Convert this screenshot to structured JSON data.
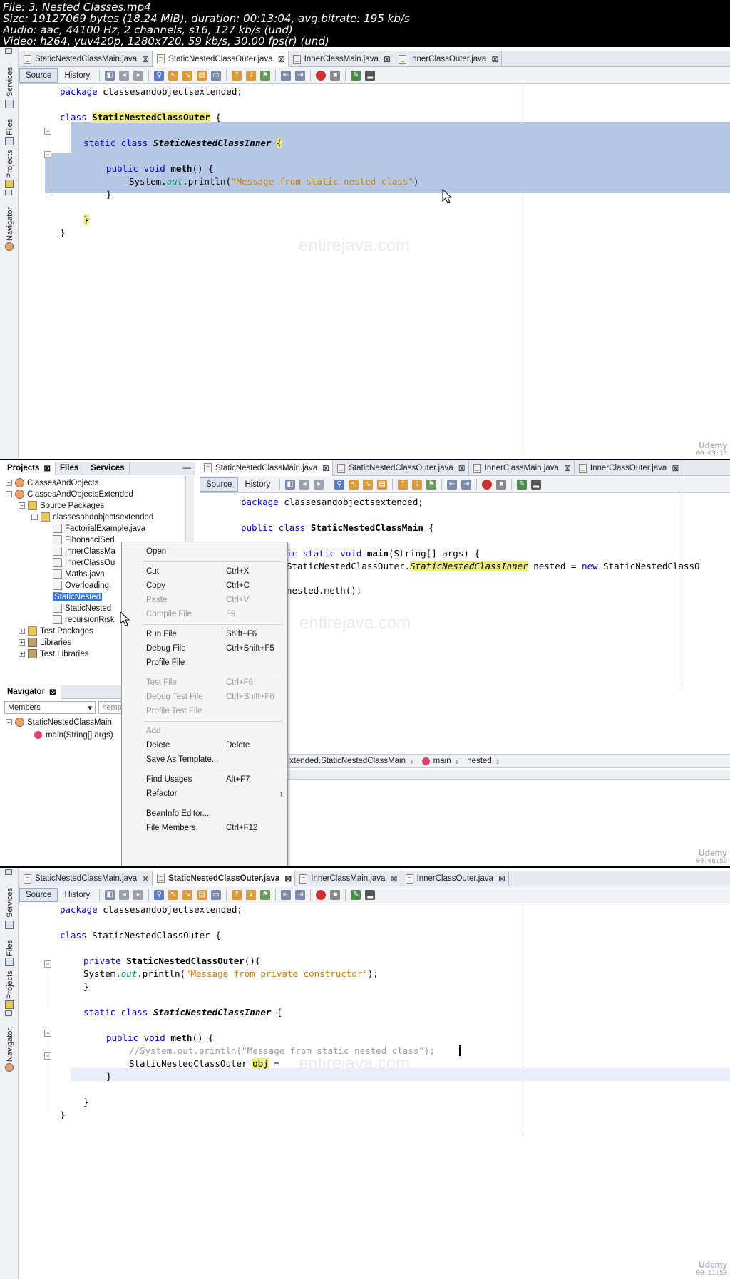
{
  "header": {
    "line1": "File: 3. Nested Classes.mp4",
    "line2": "Size: 19127069 bytes (18.24 MiB), duration: 00:13:04, avg.bitrate: 195 kb/s",
    "line3": "Audio: aac, 44100 Hz, 2 channels, s16, 127 kb/s (und)",
    "line4": "Video: h264, yuv420p, 1280x720, 59 kb/s, 30.00 fps(r) (und)"
  },
  "side_tabs": {
    "services": "Services",
    "files": "Files",
    "projects": "Projects",
    "navigator": "Navigator"
  },
  "toolbar": {
    "source": "Source",
    "history": "History"
  },
  "watermark": "entirejava.com",
  "udemy": {
    "brand": "Udemy",
    "t1": "00:03:13",
    "t2": "00:06:59",
    "t3": "00:11:53"
  },
  "frame1": {
    "tabs": [
      "StaticNestedClassMain.java",
      "StaticNestedClassOuter.java",
      "InnerClassMain.java",
      "InnerClassOuter.java"
    ],
    "code": {
      "l1_kw": "package",
      "l1_rest": " classesandobjectsextended;",
      "l2_kw": "class",
      "l2_name": "StaticNestedClassOuter",
      "l2_rest": " {",
      "l3_kw": "static class",
      "l3_name": "StaticNestedClassInner",
      "l3_brace": "{",
      "l4_kw": "public void",
      "l4_name": "meth",
      "l4_rest": "() {",
      "l5_a": "System.",
      "l5_fld": "out",
      "l5_b": ".println(",
      "l5_str": "\"Message from static nested class\"",
      "l5_c": ")",
      "l6": "}",
      "l7": "}",
      "l8": "}"
    }
  },
  "frame2": {
    "projects_tabs": [
      "Projects",
      "Files",
      "Services"
    ],
    "tree": [
      "ClassesAndObjects",
      "ClassesAndObjectsExtended",
      "Source Packages",
      "classesandobjectsextended",
      "FactorialExample.java",
      "FibonacciSeri",
      "InnerClassMa",
      "InnerClassOu",
      "Maths.java",
      "Overloading.",
      "StaticNested",
      "StaticNested",
      "recursionRisk",
      "Test Packages",
      "Libraries",
      "Test Libraries"
    ],
    "navigator_title": "Navigator",
    "members_combo": "Members",
    "empty_combo": "<emp",
    "nav_tree": [
      "StaticNestedClassMain",
      "main(String[] args)"
    ],
    "tabs": [
      "StaticNestedClassMain.java",
      "StaticNestedClassOuter.java",
      "InnerClassMain.java",
      "InnerClassOuter.java"
    ],
    "code": {
      "l1_kw": "package",
      "l1_rest": " classesandobjectsextended;",
      "l2_kw": "public class",
      "l2_name": "StaticNestedClassMain",
      "l2_rest": " {",
      "l3_kw1": "ic static void",
      "l3_name": "main",
      "l3_rest": "(String[] args) {",
      "l4_a": "StaticNestedClassOuter.",
      "l4_name": "StaticNestedClassInner",
      "l4_b": " nested = ",
      "l4_kw": "new",
      "l4_c": " StaticNestedClassO",
      "l5": "nested.meth();"
    },
    "breadcrumb": [
      "xtended.StaticNestedClassMain",
      "main",
      "nested"
    ],
    "menu": [
      {
        "label": "Open",
        "shortcut": "",
        "disabled": false
      },
      {
        "label": "Cut",
        "shortcut": "Ctrl+X",
        "disabled": false
      },
      {
        "label": "Copy",
        "shortcut": "Ctrl+C",
        "disabled": false
      },
      {
        "label": "Paste",
        "shortcut": "Ctrl+V",
        "disabled": true
      },
      {
        "label": "Compile File",
        "shortcut": "F9",
        "disabled": true
      },
      {
        "label": "Run File",
        "shortcut": "Shift+F6",
        "disabled": false
      },
      {
        "label": "Debug File",
        "shortcut": "Ctrl+Shift+F5",
        "disabled": false
      },
      {
        "label": "Profile File",
        "shortcut": "",
        "disabled": false
      },
      {
        "label": "Test File",
        "shortcut": "Ctrl+F6",
        "disabled": true
      },
      {
        "label": "Debug Test File",
        "shortcut": "Ctrl+Shift+F6",
        "disabled": true
      },
      {
        "label": "Profile Test File",
        "shortcut": "",
        "disabled": true
      },
      {
        "label": "Add",
        "shortcut": "",
        "disabled": true
      },
      {
        "label": "Delete",
        "shortcut": "Delete",
        "disabled": false
      },
      {
        "label": "Save As Template...",
        "shortcut": "",
        "disabled": false
      },
      {
        "label": "Find Usages",
        "shortcut": "Alt+F7",
        "disabled": false
      },
      {
        "label": "Refactor",
        "shortcut": "",
        "disabled": false
      },
      {
        "label": "BeanInfo Editor...",
        "shortcut": "",
        "disabled": false
      },
      {
        "label": "File Members",
        "shortcut": "Ctrl+F12",
        "disabled": false
      }
    ]
  },
  "frame3": {
    "tabs": [
      "StaticNestedClassMain.java",
      "StaticNestedClassOuter.java",
      "InnerClassMain.java",
      "InnerClassOuter.java"
    ],
    "code": {
      "l1_kw": "package",
      "l1_rest": " classesandobjectsextended;",
      "l2_kw": "class",
      "l2_rest": " StaticNestedClassOuter {",
      "l3_kw": "private",
      "l3_name": "StaticNestedClassOuter",
      "l3_rest": "(){",
      "l4_a": "System.",
      "l4_fld": "out",
      "l4_b": ".println(",
      "l4_str": "\"Message from private constructor\"",
      "l4_c": ");",
      "l5": "}",
      "l6_kw": "static class",
      "l6_name": "StaticNestedClassInner",
      "l6_rest": " {",
      "l7_kw": "public void",
      "l7_name": "meth",
      "l7_rest": "() {",
      "l8": "//System.out.println(\"Message from static nested class\");",
      "l9_a": "StaticNestedClassOuter ",
      "l9_hl": "obj",
      "l9_b": " =",
      "l10": "}",
      "l11": "}",
      "l12": "}"
    }
  }
}
